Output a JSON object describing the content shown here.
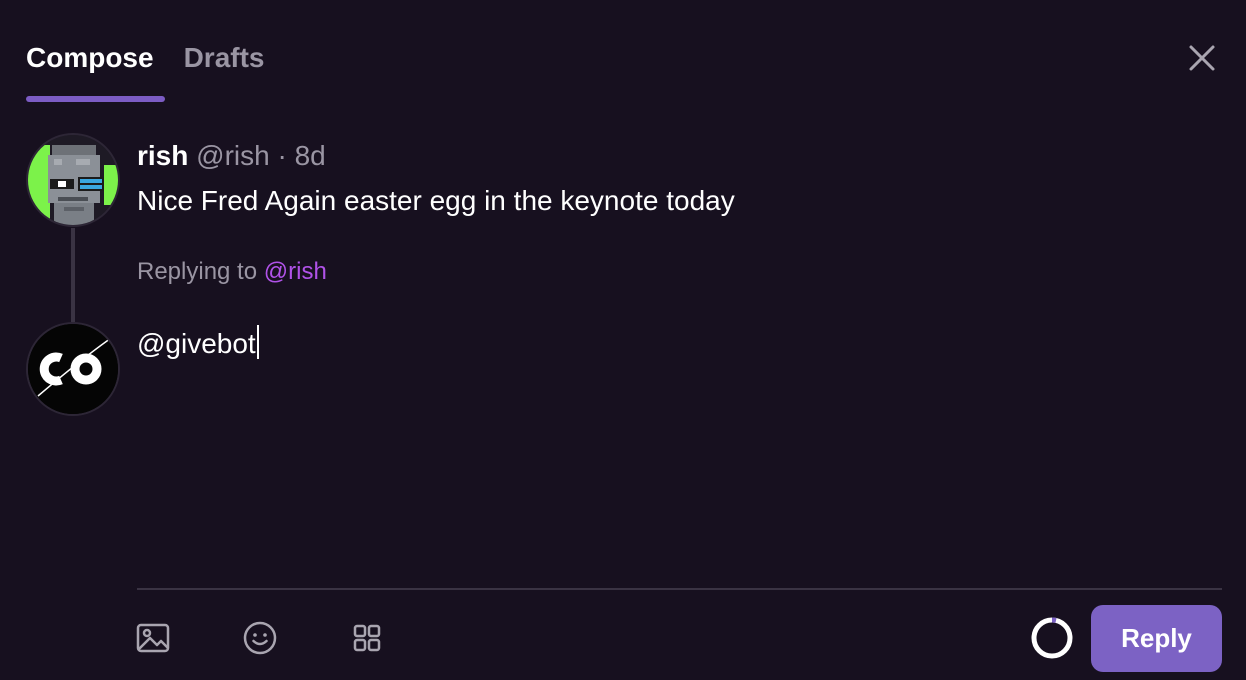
{
  "tabs": [
    {
      "label": "Compose",
      "active": true
    },
    {
      "label": "Drafts",
      "active": false
    }
  ],
  "original_cast": {
    "author_display": "rish",
    "author_handle": "@rish",
    "separator": "·",
    "age": "8d",
    "text": "Nice Fred Again easter egg in the keynote today"
  },
  "replying": {
    "prefix": "Replying to",
    "handle": "@rish"
  },
  "composer": {
    "text": "@givebot"
  },
  "toolbar": {
    "reply_label": "Reply",
    "icons": [
      "image-icon",
      "emoji-icon",
      "apps-grid-icon"
    ]
  },
  "colors": {
    "background": "#17101f",
    "accent": "#7c62c4",
    "mention": "#b052e8",
    "muted_text": "#9a95a3"
  }
}
